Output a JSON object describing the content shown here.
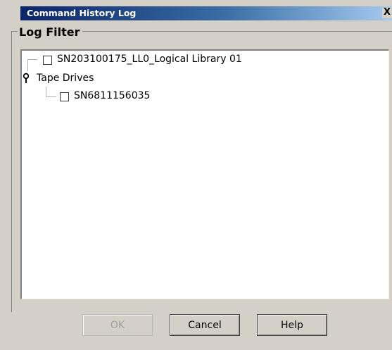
{
  "window": {
    "title": "Command History Log",
    "close_label": "X"
  },
  "group": {
    "label": "Log Filter"
  },
  "tree": {
    "items": [
      {
        "label": "SN203100175_LL0_Logical Library 01",
        "checked": false
      },
      {
        "label": "Tape Drives",
        "expanded": true
      },
      {
        "label": "SN6811156035",
        "checked": false
      }
    ]
  },
  "buttons": {
    "ok": "OK",
    "cancel": "Cancel",
    "help": "Help"
  }
}
